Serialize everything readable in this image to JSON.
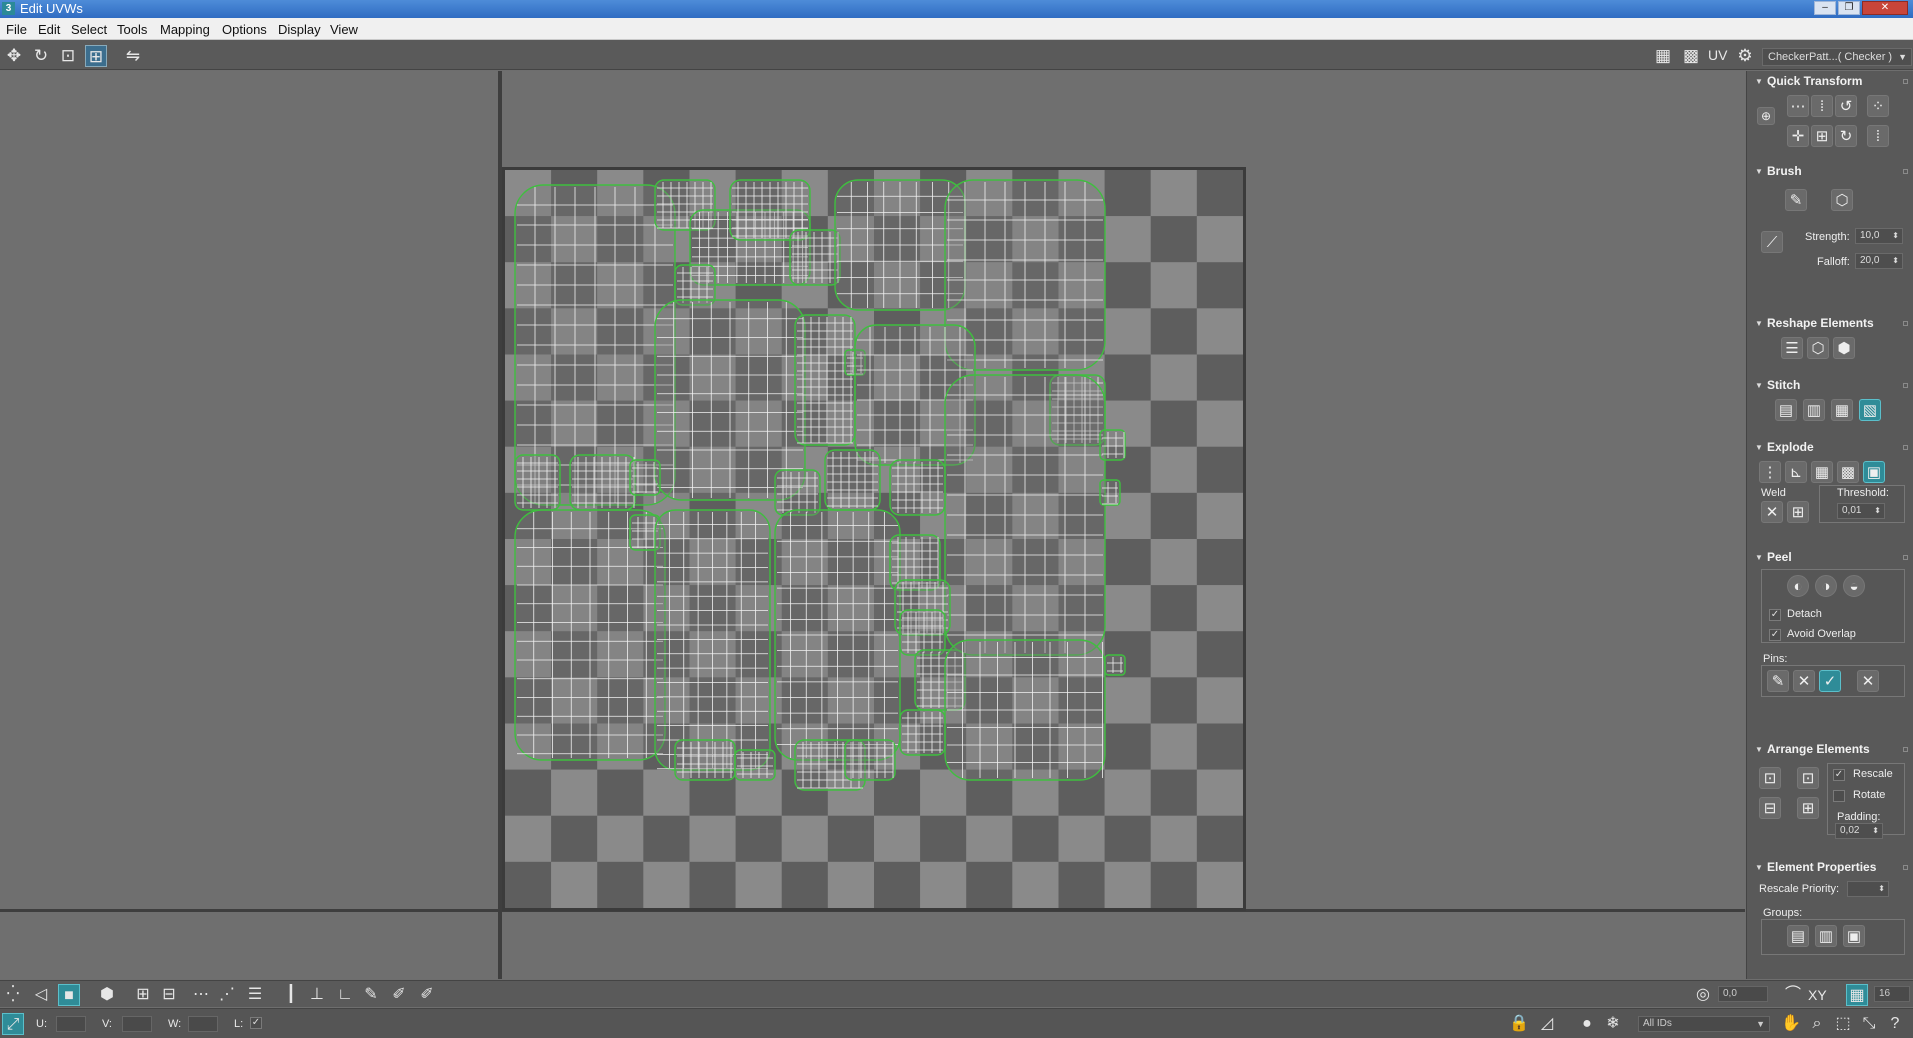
{
  "window": {
    "title": "Edit UVWs",
    "app_icon_label": "3"
  },
  "menu": [
    "File",
    "Edit",
    "Select",
    "Tools",
    "Mapping",
    "Options",
    "Display",
    "View"
  ],
  "toolbar": {
    "tools": [
      "move-icon",
      "rotate-icon",
      "scale-icon",
      "freeform-icon",
      "mirror-icon"
    ],
    "uv_label": "UV",
    "checker_dropdown": "CheckerPatt...( Checker )",
    "right_icons": [
      "show-grid-icon",
      "checker-map-icon",
      "uv-settings-icon"
    ]
  },
  "panel": {
    "quick_transform": {
      "title": "Quick Transform"
    },
    "brush": {
      "title": "Brush",
      "strength_label": "Strength:",
      "strength_value": "10,0",
      "falloff_label": "Falloff:",
      "falloff_value": "20,0"
    },
    "reshape": {
      "title": "Reshape Elements"
    },
    "stitch": {
      "title": "Stitch"
    },
    "explode": {
      "title": "Explode",
      "weld_label": "Weld",
      "threshold_label": "Threshold:",
      "threshold_value": "0,01"
    },
    "peel": {
      "title": "Peel",
      "detach_label": "Detach",
      "detach_checked": true,
      "avoid_overlap_label": "Avoid Overlap",
      "avoid_overlap_checked": true,
      "pins_label": "Pins:"
    },
    "arrange": {
      "title": "Arrange Elements",
      "rescale_label": "Rescale",
      "rescale_checked": true,
      "rotate_label": "Rotate",
      "rotate_checked": false,
      "padding_label": "Padding:",
      "padding_value": "0,02"
    },
    "element_props": {
      "title": "Element Properties",
      "rescale_priority_label": "Rescale Priority:",
      "groups_label": "Groups:"
    }
  },
  "bottom": {
    "soft_value": "0,0",
    "xy_label": "XY",
    "grid_value": "16",
    "u_label": "U:",
    "v_label": "V:",
    "w_label": "W:",
    "l_label": "L:",
    "ids_dropdown": "All IDs"
  },
  "colors": {
    "accent": "#2f8c98",
    "seam": "#3fbf3f",
    "checker_dark": "#5e5e5e",
    "checker_light": "#8a8a8a"
  }
}
